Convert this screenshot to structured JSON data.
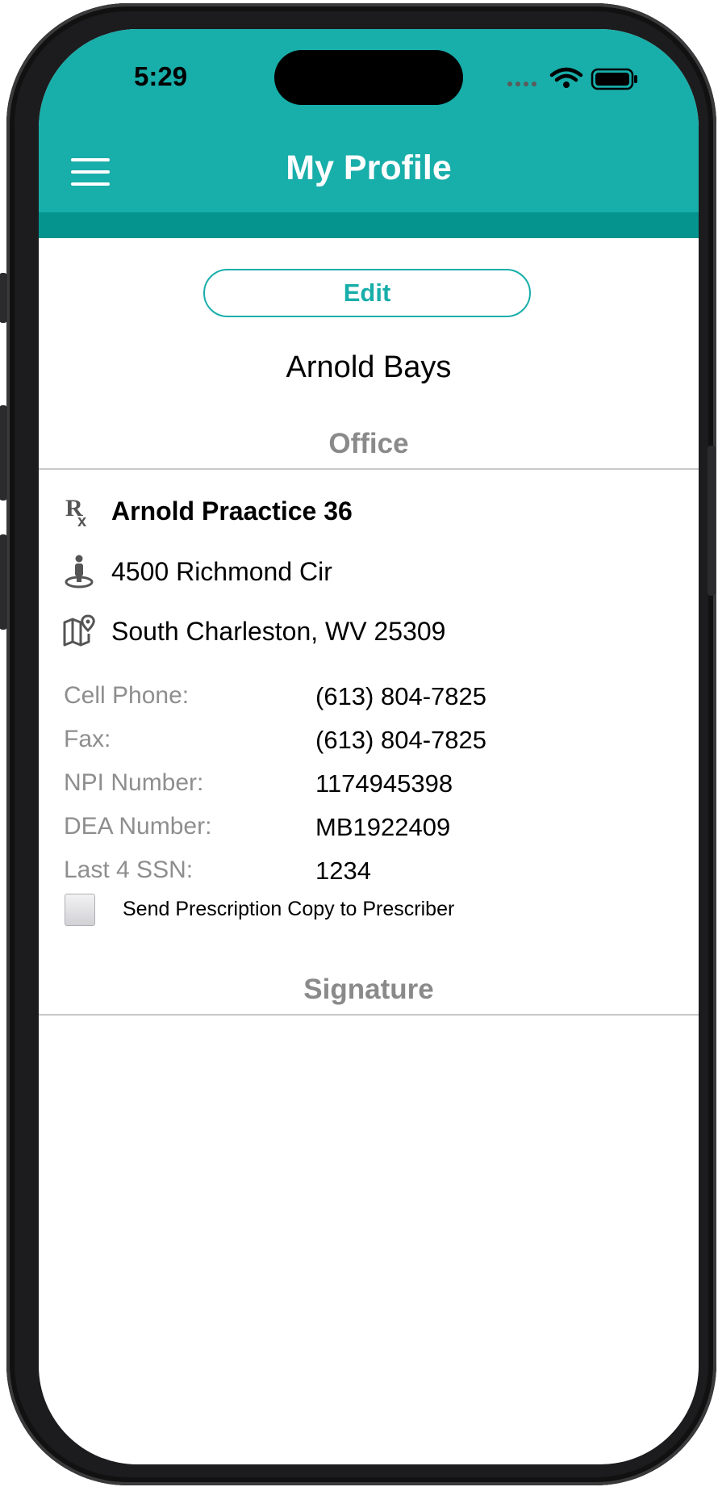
{
  "status_bar": {
    "time": "5:29"
  },
  "header": {
    "title": "My Profile",
    "menu_icon": "hamburger-menu-icon",
    "color": "#18aeaa",
    "band_color": "#06948f"
  },
  "profile": {
    "edit_label": "Edit",
    "name": "Arnold Bays"
  },
  "office": {
    "section_title": "Office",
    "practice_name": "Arnold Praactice 36",
    "address_line": "4500 Richmond Cir",
    "city_state_zip": "South Charleston, WV 25309",
    "icons": {
      "practice": "rx-icon",
      "address": "person-location-icon",
      "city": "map-pin-icon"
    },
    "fields": [
      {
        "label": "Cell Phone:",
        "value": "(613) 804-7825"
      },
      {
        "label": "Fax:",
        "value": "(613) 804-7825"
      },
      {
        "label": "NPI Number:",
        "value": "1174945398"
      },
      {
        "label": "DEA Number:",
        "value": "MB1922409"
      },
      {
        "label": "Last 4 SSN:",
        "value": "1234"
      }
    ],
    "send_copy_label": "Send Prescription Copy to Prescriber",
    "send_copy_checked": false
  },
  "signature": {
    "section_title": "Signature"
  }
}
